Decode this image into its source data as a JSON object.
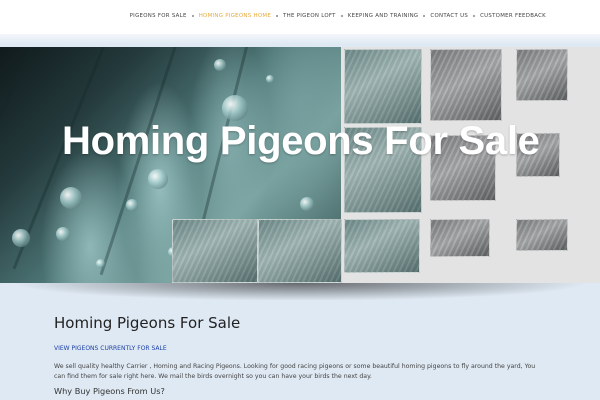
{
  "nav": {
    "items": [
      {
        "label": "PIGEONS FOR SALE",
        "active": false
      },
      {
        "label": "HOMING PIGEONS HOME",
        "active": true
      },
      {
        "label": "THE PIGEON LOFT",
        "active": false
      },
      {
        "label": "KEEPING AND TRAINING",
        "active": false
      },
      {
        "label": "CONTACT US",
        "active": false
      },
      {
        "label": "CUSTOMER FEEDBACK",
        "active": false
      }
    ],
    "active_color": "#e6a93a"
  },
  "hero": {
    "title": "Homing Pigeons For Sale"
  },
  "main": {
    "title": "Homing Pigeons For Sale",
    "view_link": "VIEW PIGEONS CURRENTLY FOR SALE",
    "intro": "We sell quality healthy Carrier , Homing and Racing Pigeons. Looking for good racing pigeons or some beautiful homing pigeons to fly around the yard, You can find them for sale right here. We mail the birds overnight so you can have your birds the next day.",
    "sub_heading": "Why Buy Pigeons From Us?"
  },
  "colors": {
    "page_background": "#dfe9f3",
    "link": "#1a3fa6",
    "hero_background": "#e3e3e3"
  }
}
